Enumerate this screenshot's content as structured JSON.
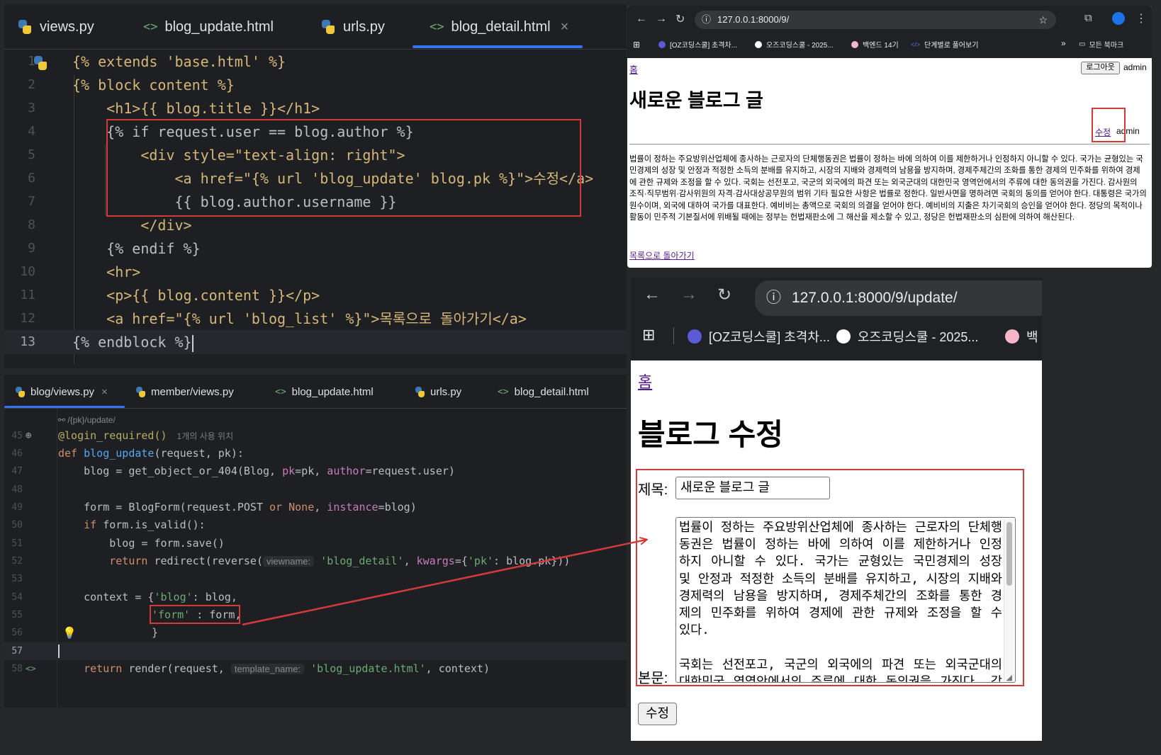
{
  "editor_top": {
    "tabs": [
      "views.py",
      "blog_update.html",
      "urls.py",
      "blog_detail.html"
    ],
    "close_glyph": "×",
    "lines": [
      {
        "n": "1",
        "t": "{% extends 'base.html' %}"
      },
      {
        "n": "2",
        "t": "{% block content %}"
      },
      {
        "n": "3",
        "t": "    <h1>{{ blog.title }}</h1>"
      },
      {
        "n": "4",
        "t": "    {% if request.user == blog.author %}"
      },
      {
        "n": "5",
        "t": "        <div style=\"text-align: right\">"
      },
      {
        "n": "6",
        "t": "            <a href=\"{% url 'blog_update' blog.pk %}\">수정</a>"
      },
      {
        "n": "7",
        "t": "            {{ blog.author.username }}"
      },
      {
        "n": "8",
        "t": "        </div>"
      },
      {
        "n": "9",
        "t": "    {% endif %}"
      },
      {
        "n": "10",
        "t": "    <hr>"
      },
      {
        "n": "11",
        "t": "    <p>{{ blog.content }}</p>"
      },
      {
        "n": "12",
        "t": "    <a href=\"{% url 'blog_list' %}\">목록으로 돌아가기</a>"
      },
      {
        "n": "13",
        "t": "{% endblock %}"
      }
    ]
  },
  "editor_bottom": {
    "tabs": [
      "blog/views.py",
      "member/views.py",
      "blog_update.html",
      "urls.py",
      "blog_detail.html"
    ],
    "close_glyph": "×",
    "route_hint": "/{pk}/update/",
    "usage_hint": "1개의 사용 위치",
    "line_numbers": [
      "45",
      "46",
      "47",
      "48",
      "49",
      "50",
      "51",
      "52",
      "53",
      "54",
      "55",
      "56",
      "57",
      "58"
    ],
    "code": {
      "l45": "@login_required()",
      "l46_def": "def ",
      "l46_fn": "blog_update",
      "l46_rest": "(request, pk):",
      "l47": "    blog = get_object_or_404(Blog, ",
      "l47_pk": "pk",
      "l47_mid": "=pk, ",
      "l47_author": "author",
      "l47_end": "=request.user)",
      "l49": "    form = BlogForm(request.POST ",
      "l49_or": "or",
      "l49_none": " None",
      "l49_comma": ", ",
      "l49_inst": "instance",
      "l49_end": "=blog)",
      "l50_if": "    if",
      "l50_rest": " form.is_valid():",
      "l51": "        blog = form.save()",
      "l52_ret": "        return",
      "l52_mid": " redirect(reverse(",
      "l52_hint": "viewname:",
      "l52_str": " 'blog_detail'",
      "l52_comma": ", ",
      "l52_kw": "kwargs",
      "l52_eq": "={",
      "l52_pk": "'pk'",
      "l52_end": ": blog.pk}))",
      "l54_a": "    context = {",
      "l54_str": "'blog'",
      "l54_b": ": blog,",
      "l55_str": "'form'",
      "l55_b": " : form,",
      "l56": "}",
      "l58_ret": "    return",
      "l58_mid": " render(request, ",
      "l58_hint": "template_name:",
      "l58_str": " 'blog_update.html'",
      "l58_end": ", context)"
    }
  },
  "browser_detail": {
    "url": "127.0.0.1:8000/9/",
    "bookmarks": [
      "[OZ코딩스쿨] 초격차...",
      "오즈코딩스쿨 - 2025...",
      "백엔드 14기",
      "단계별로 풀어보기",
      "모든 북마크"
    ],
    "home_link": "홈",
    "logout_button": "로그아웃",
    "username": "admin",
    "title": "새로운 블로그 글",
    "edit_link": "수정",
    "author": "admin",
    "content": "법률이 정하는 주요방위산업체에 종사하는 근로자의 단체행동권은 법률이 정하는 바에 의하여 이를 제한하거나 인정하지 아니할 수 있다. 국가는 균형있는 국민경제의 성장 및 안정과 적정한 소득의 분배를 유지하고, 시장의 지배와 경제력의 남용을 방지하며, 경제주체간의 조화를 통한 경제의 민주화를 위하여 경제에 관한 규제와 조정을 할 수 있다. 국회는 선전포고, 국군의 외국에의 파견 또는 외국군대의 대한민국 영역안에서의 주류에 대한 동의권을 가진다. 감사원의 조직·직무범위·감사위원의 자격·감사대상공무원의 범위 기타 필요한 사항은 법률로 정한다. 일반사면을 명하려면 국회의 동의를 얻어야 한다. 대통령은 국가의 원수이며, 외국에 대하여 국가를 대표한다. 예비비는 총액으로 국회의 의결을 얻어야 한다. 예비비의 지출은 차기국회의 승인을 얻어야 한다. 정당의 목적이나 활동이 민주적 기본질서에 위배될 때에는 정부는 헌법재판소에 그 해산을 제소할 수 있고, 정당은 헌법재판소의 심판에 의하여 해산된다.",
    "back_link": "목록으로 돌아가기"
  },
  "browser_update": {
    "url": "127.0.0.1:8000/9/update/",
    "bookmarks": [
      "[OZ코딩스쿨] 초격차...",
      "오즈코딩스쿨 - 2025...",
      "백"
    ],
    "home_link": "홈",
    "heading": "블로그 수정",
    "title_label": "제목:",
    "title_value": "새로운 블로그 글",
    "content_label": "본문:",
    "content_value": "법률이 정하는 주요방위산업체에 종사하는 근로자의 단체행동권은 법률이 정하는 바에 의하여 이를 제한하거나 인정하지 아니할 수 있다. 국가는 균형있는 국민경제의 성장 및 안정과 적정한 소득의 분배를 유지하고, 시장의 지배와 경제력의 남용을 방지하며, 경제주체간의 조화를 통한 경제의 민주화를 위하여 경제에 관한 규제와 조정을 할 수 있다.\n\n국회는 선전포고, 국군의 외국에의 파견 또는 외국군대의 대한민국 영역안에서의 주류에 대한 동의권을 가진다. 감사원의 조직·직무범위·감사위원의 자격·감사대상공무원의 범위 기타 필요한 사항은 법률로 정한다.",
    "submit_button": "수정"
  },
  "colors": {
    "highlight_red": "#d33b3b",
    "editor_bg": "#1e1f22",
    "link_purple": "#551a8b",
    "tab_accent": "#3574f0"
  }
}
